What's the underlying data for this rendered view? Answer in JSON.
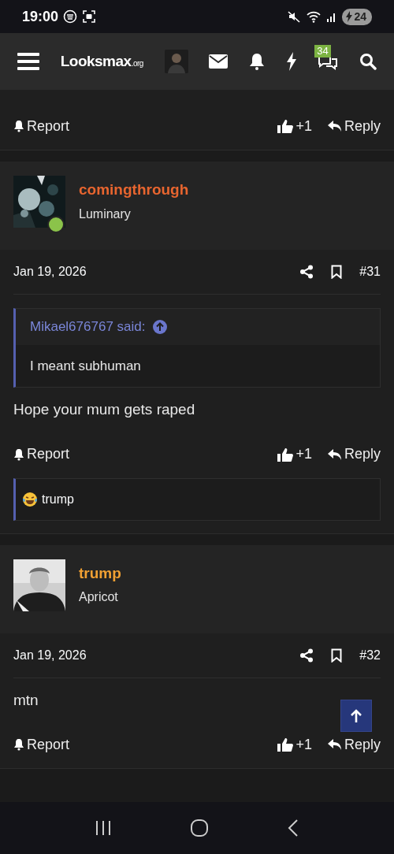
{
  "status_bar": {
    "time": "19:00",
    "battery": "24"
  },
  "navbar": {
    "logo": "Looksmax",
    "logo_suffix": ".org",
    "conversations_badge": "34"
  },
  "posts": [
    {
      "kind": "tail",
      "actions": {
        "report": "Report",
        "likes": "+1",
        "reply": "Reply"
      }
    },
    {
      "kind": "full",
      "author": "comingthrough",
      "color": "#e8652f",
      "title": "Luminary",
      "online": true,
      "date": "Jan 19, 2026",
      "number": "#31",
      "quote": {
        "author": "Mikael676767 said:",
        "text": "I meant subhuman"
      },
      "body": "Hope your mum gets raped",
      "actions": {
        "report": "Report",
        "likes": "+1",
        "reply": "Reply"
      },
      "reactions": {
        "user": "trump"
      }
    },
    {
      "kind": "full",
      "author": "trump",
      "color": "#f0a033",
      "title": "Apricot",
      "online": false,
      "date": "Jan 19, 2026",
      "number": "#32",
      "body": "mtn",
      "actions": {
        "report": "Report",
        "likes": "+1",
        "reply": "Reply"
      }
    }
  ]
}
